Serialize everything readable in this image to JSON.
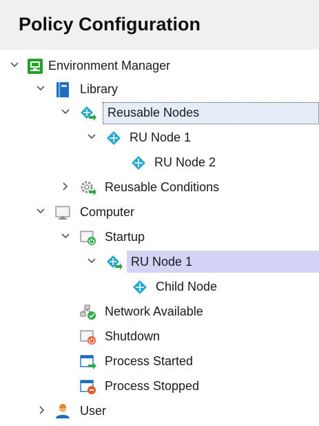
{
  "panel": {
    "title": "Policy Configuration",
    "collapse_icon": "chevron-left-icon"
  },
  "tree": {
    "environment_manager": "Environment Manager",
    "library": "Library",
    "reusable_nodes": "Reusable Nodes",
    "ru_node_1": "RU Node 1",
    "ru_node_2": "RU Node 2",
    "reusable_conditions": "Reusable Conditions",
    "computer": "Computer",
    "startup": "Startup",
    "startup_ru_node_1": "RU Node 1",
    "child_node": "Child Node",
    "network_available": "Network Available",
    "shutdown": "Shutdown",
    "process_started": "Process Started",
    "process_stopped": "Process Stopped",
    "user": "User"
  },
  "colors": {
    "selection_light": "#e5eef8",
    "selection_active": "#d4d2f5",
    "node_teal": "#28a8c8",
    "env_green": "#22a02a",
    "arrow_green": "#2ea84a"
  }
}
